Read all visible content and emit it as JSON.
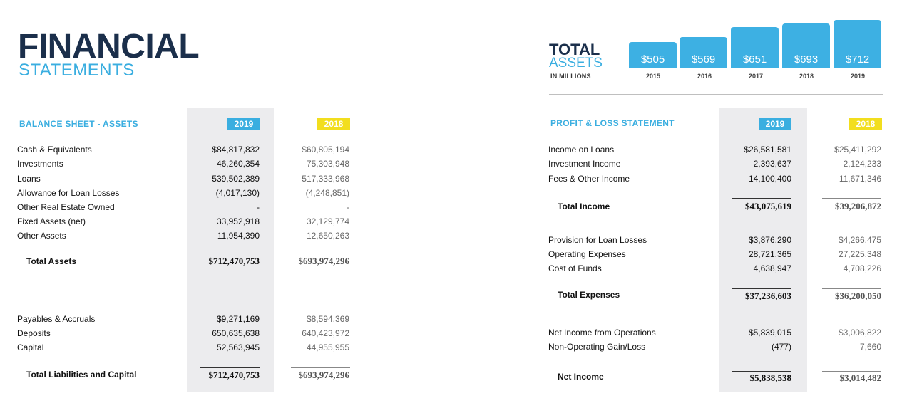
{
  "header": {
    "title": "FINANCIAL",
    "subtitle": "STATEMENTS"
  },
  "total_assets": {
    "title": "TOTAL",
    "subtitle": "ASSETS",
    "unit": "IN MILLIONS",
    "bars": [
      {
        "value": "$505",
        "year": "2015"
      },
      {
        "value": "$569",
        "year": "2016"
      },
      {
        "value": "$651",
        "year": "2017"
      },
      {
        "value": "$693",
        "year": "2018"
      },
      {
        "value": "$712",
        "year": "2019"
      }
    ]
  },
  "balance_sheet": {
    "heading": "BALANCE SHEET - ASSETS",
    "col_2019": "2019",
    "col_2018": "2018",
    "assets": [
      {
        "label": "Cash & Equivalents",
        "v2019": "$84,817,832",
        "v2018": "$60,805,194"
      },
      {
        "label": "Investments",
        "v2019": "46,260,354",
        "v2018": "75,303,948"
      },
      {
        "label": "Loans",
        "v2019": "539,502,389",
        "v2018": "517,333,968"
      },
      {
        "label": "Allowance for Loan Losses",
        "v2019": "(4,017,130)",
        "v2018": "(4,248,851)"
      },
      {
        "label": "Other Real Estate Owned",
        "v2019": "-",
        "v2018": "-"
      },
      {
        "label": "Fixed Assets (net)",
        "v2019": "33,952,918",
        "v2018": "32,129,774"
      },
      {
        "label": "Other Assets",
        "v2019": "11,954,390",
        "v2018": "12,650,263"
      }
    ],
    "total_assets": {
      "label": "Total Assets",
      "v2019": "$712,470,753",
      "v2018": "$693,974,296"
    },
    "liabilities": [
      {
        "label": "Payables & Accruals",
        "v2019": "$9,271,169",
        "v2018": "$8,594,369"
      },
      {
        "label": "Deposits",
        "v2019": "650,635,638",
        "v2018": "640,423,972"
      },
      {
        "label": "Capital",
        "v2019": "52,563,945",
        "v2018": "44,955,955"
      }
    ],
    "total_liabilities": {
      "label": "Total Liabilities and Capital",
      "v2019": "$712,470,753",
      "v2018": "$693,974,296"
    }
  },
  "profit_loss": {
    "heading": "PROFIT & LOSS STATEMENT",
    "col_2019": "2019",
    "col_2018": "2018",
    "income": [
      {
        "label": "Income on Loans",
        "v2019": "$26,581,581",
        "v2018": "$25,411,292"
      },
      {
        "label": "Investment Income",
        "v2019": "2,393,637",
        "v2018": "2,124,233"
      },
      {
        "label": "Fees & Other Income",
        "v2019": "14,100,400",
        "v2018": "11,671,346"
      }
    ],
    "total_income": {
      "label": "Total Income",
      "v2019": "$43,075,619",
      "v2018": "$39,206,872"
    },
    "expenses": [
      {
        "label": "Provision for Loan Losses",
        "v2019": "$3,876,290",
        "v2018": "$4,266,475"
      },
      {
        "label": "Operating Expenses",
        "v2019": "28,721,365",
        "v2018": "27,225,348"
      },
      {
        "label": "Cost of Funds",
        "v2019": "4,638,947",
        "v2018": "4,708,226"
      }
    ],
    "total_expenses": {
      "label": "Total Expenses",
      "v2019": "$37,236,603",
      "v2018": "$36,200,050"
    },
    "operations": [
      {
        "label": "Net Income from Operations",
        "v2019": "$5,839,015",
        "v2018": "$3,006,822"
      },
      {
        "label": "Non-Operating Gain/Loss",
        "v2019": "(477)",
        "v2018": "7,660"
      }
    ],
    "net_income": {
      "label": "Net Income",
      "v2019": "$5,838,538",
      "v2018": "$3,014,482"
    }
  }
}
